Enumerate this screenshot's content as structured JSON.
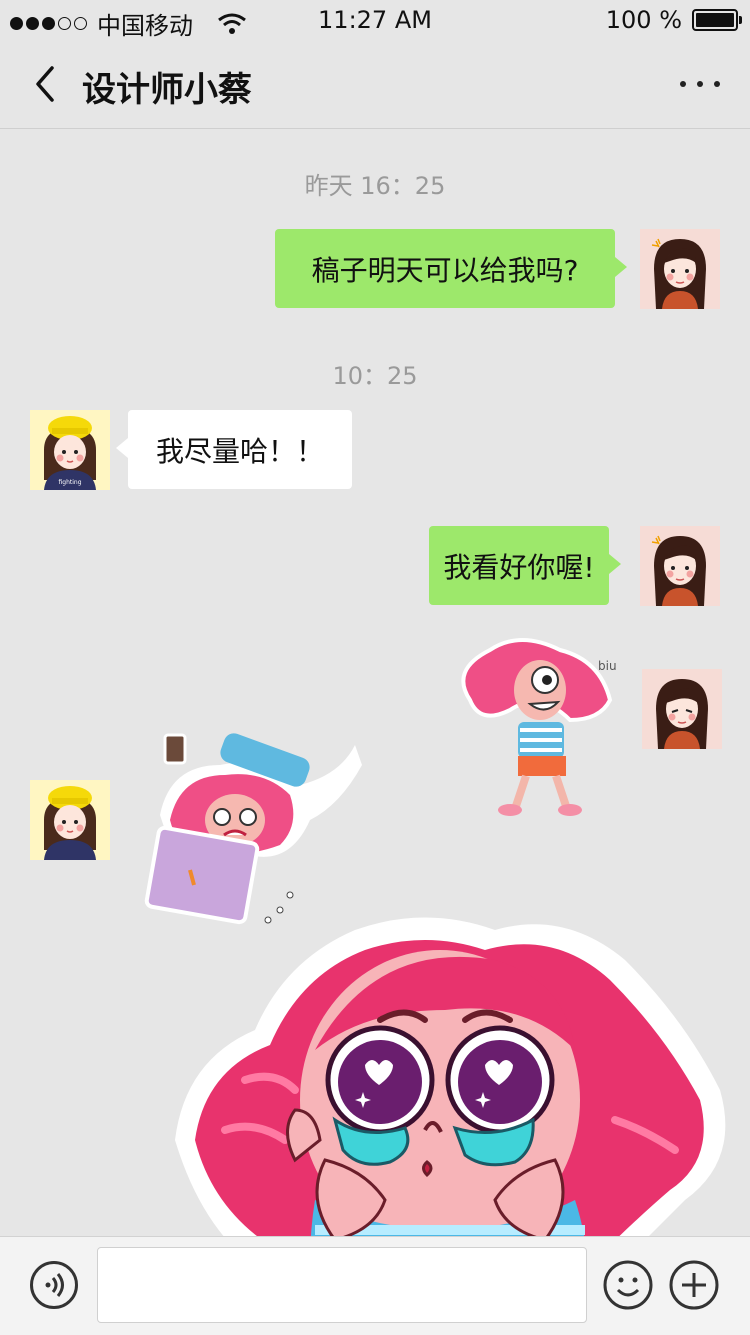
{
  "status_bar": {
    "carrier": "中国移动",
    "time": "11:27 AM",
    "battery": "100 %"
  },
  "nav": {
    "title": "设计师小蔡"
  },
  "messages": [
    {
      "type": "timestamp",
      "text": "昨天 16：25"
    },
    {
      "type": "text",
      "side": "right",
      "text": "稿子明天可以给我吗?"
    },
    {
      "type": "timestamp",
      "text": "10：25"
    },
    {
      "type": "text",
      "side": "left",
      "text": "我尽量哈！！"
    },
    {
      "type": "text",
      "side": "right",
      "text": "我看好你喔!"
    },
    {
      "type": "sticker",
      "side": "right",
      "description": "laughing-sticker"
    },
    {
      "type": "sticker",
      "side": "left",
      "description": "working-sticker"
    },
    {
      "type": "sticker",
      "side": "right",
      "description": "crying-sticker"
    }
  ],
  "sticker_text": {
    "biu": "biu ♪ biu",
    "shirt": "fighting"
  },
  "input": {
    "placeholder": ""
  },
  "colors": {
    "background": "#e6e6e6",
    "green_bubble": "#9de86b",
    "white_bubble": "#ffffff"
  }
}
